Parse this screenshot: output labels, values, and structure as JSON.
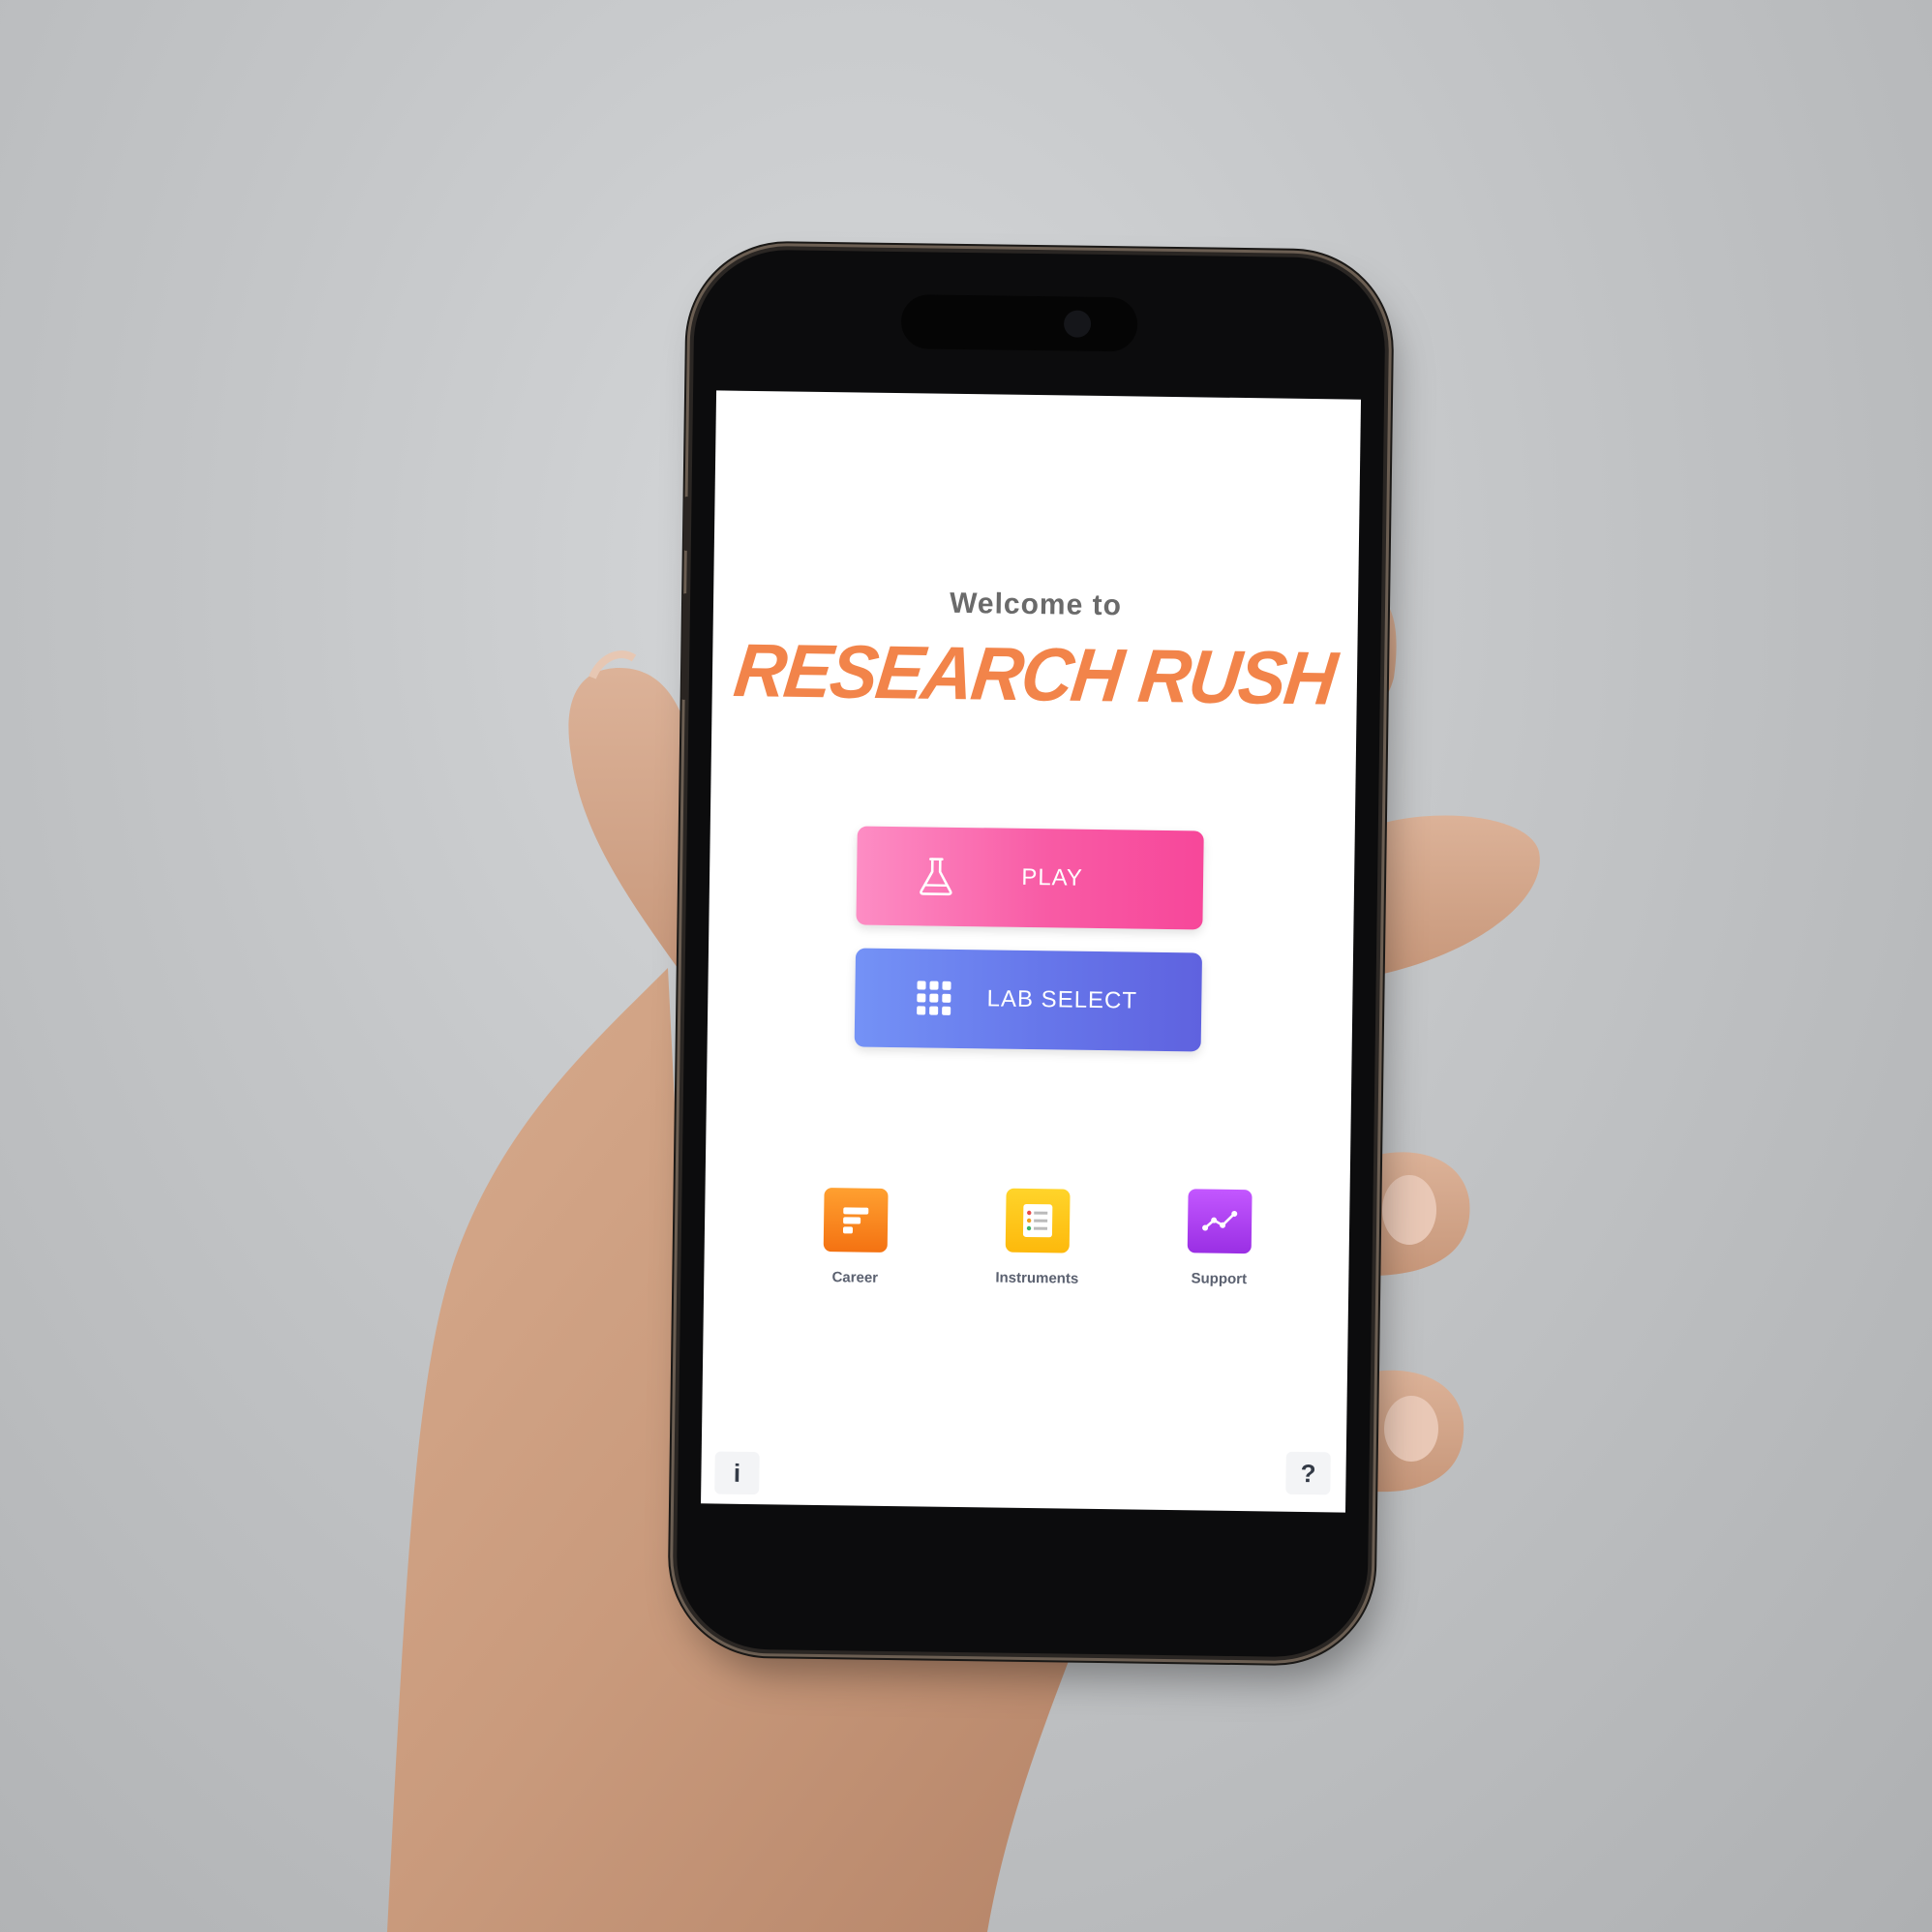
{
  "app": {
    "welcome_text": "Welcome to",
    "title": "RESEARCH RUSH"
  },
  "buttons": {
    "play": {
      "label": "PLAY",
      "icon": "flask-icon",
      "color_from": "#fd8dc4",
      "color_to": "#f7479a"
    },
    "lab_select": {
      "label": "LAB SELECT",
      "icon": "grid-icon",
      "color_from": "#7492f6",
      "color_to": "#5f62df"
    }
  },
  "features": [
    {
      "label": "Career",
      "icon": "career-icon",
      "color": "#f47f1a"
    },
    {
      "label": "Instruments",
      "icon": "instruments-icon",
      "color": "#fdc414"
    },
    {
      "label": "Support",
      "icon": "support-icon",
      "color": "#a93ef0"
    }
  ],
  "corners": {
    "info": "i",
    "help": "?"
  },
  "colors": {
    "title": "#f2844a",
    "welcome": "#6a6a6a",
    "caption": "#5b6170"
  }
}
